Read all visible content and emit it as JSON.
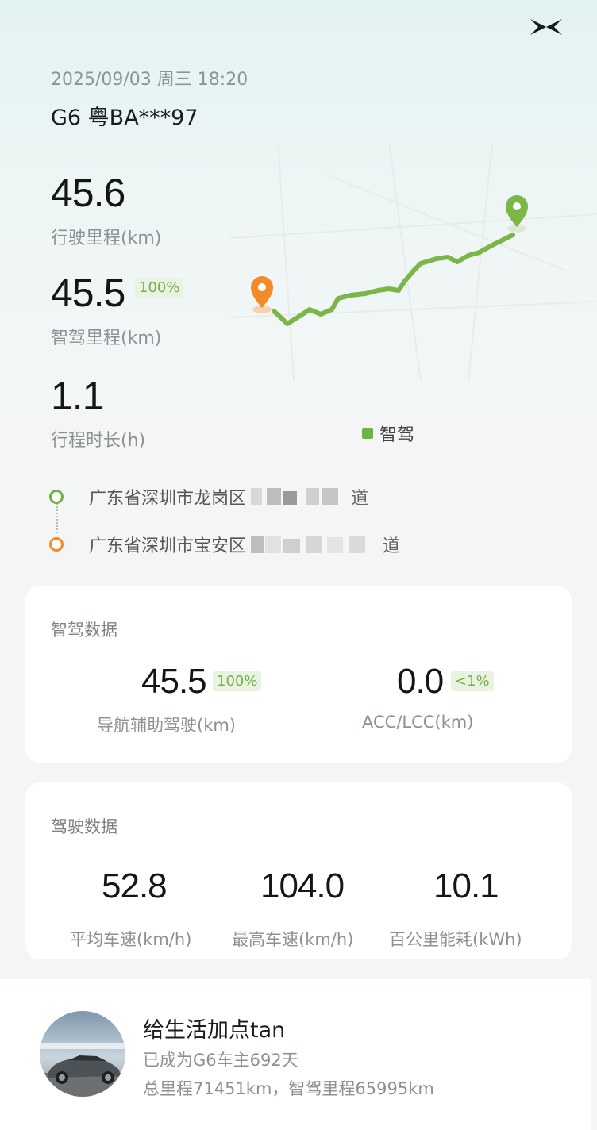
{
  "header": {
    "datetime": "2025/09/03 周三 18:20",
    "vehicle": "G6 粤BA***97",
    "logo_icon": "xpeng-logo-icon"
  },
  "trip_summary": {
    "distance_value": "45.6",
    "distance_label": "行驶里程(km)",
    "assisted_value": "45.5",
    "assisted_percent": "100%",
    "assisted_label": "智驾里程(km)",
    "duration_value": "1.1",
    "duration_label": "行程时长(h)"
  },
  "map": {
    "legend_label": "智驾",
    "route_color": "#7ab648",
    "start_marker_color": "#f28c28",
    "end_marker_color": "#7ab648"
  },
  "route": {
    "start_address": "广东省深圳市龙岗区",
    "start_address_tail": "道",
    "end_address": "广东省深圳市宝安区",
    "end_address_tail": "道"
  },
  "assisted_data": {
    "title": "智驾数据",
    "nav_value": "45.5",
    "nav_percent": "100%",
    "nav_label": "导航辅助驾驶(km)",
    "acc_value": "0.0",
    "acc_percent": "<1%",
    "acc_label": "ACC/LCC(km)"
  },
  "driving_data": {
    "title": "驾驶数据",
    "avg_speed_value": "52.8",
    "avg_speed_label": "平均车速(km/h)",
    "max_speed_value": "104.0",
    "max_speed_label": "最高车速(km/h)",
    "consumption_value": "10.1",
    "consumption_label": "百公里能耗(kWh)"
  },
  "owner": {
    "motto": "给生活加点tan",
    "owner_days": "已成为G6车主692天",
    "totals": "总里程71451km，智驾里程65995km"
  }
}
